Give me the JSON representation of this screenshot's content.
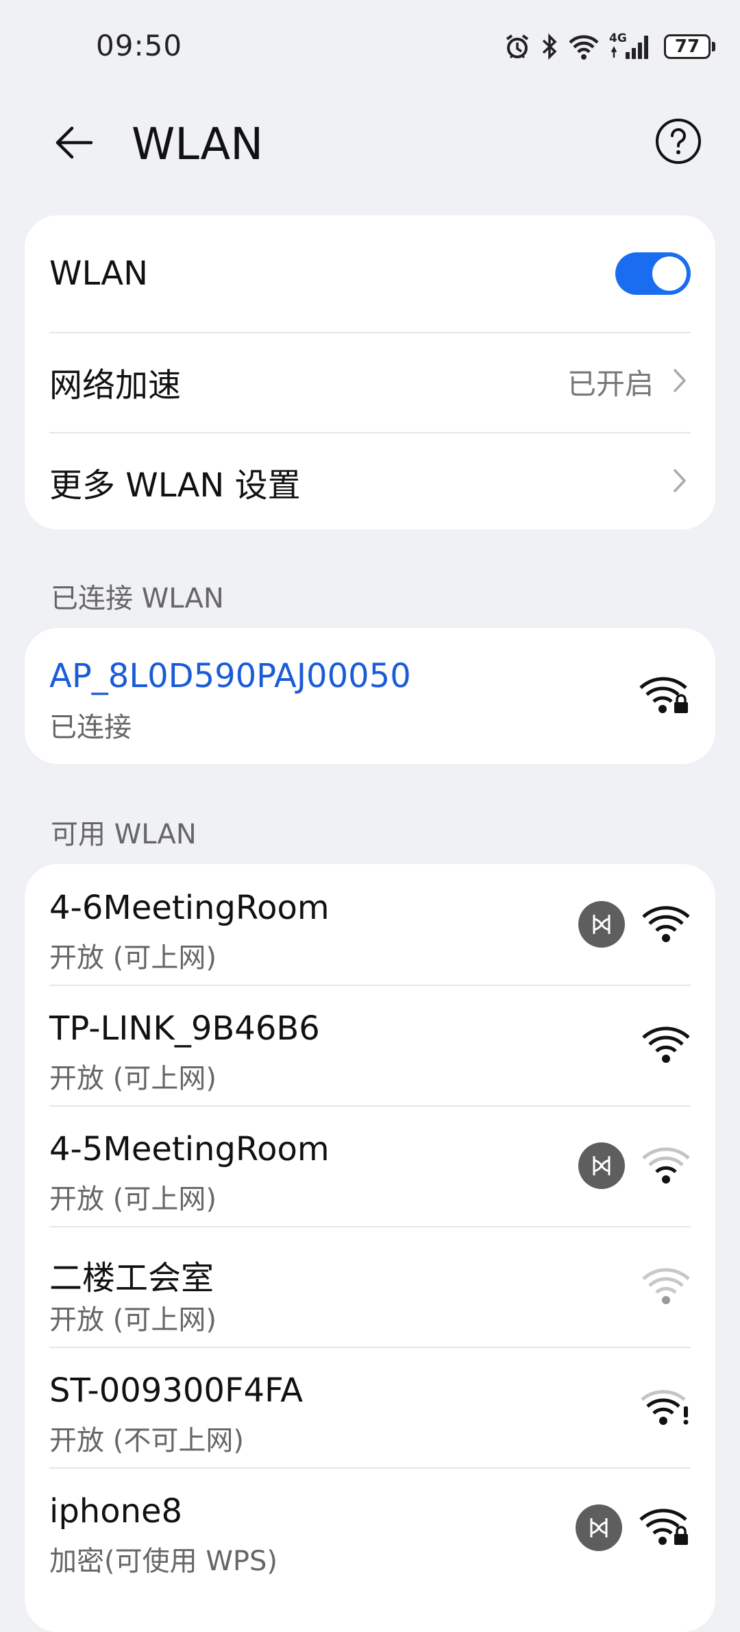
{
  "status_bar": {
    "time": "09:50",
    "network_type": "4G",
    "battery": "77",
    "icons": [
      "alarm-icon",
      "bluetooth-icon",
      "wifi-icon",
      "cellular-signal-icon",
      "battery-icon"
    ]
  },
  "header": {
    "title": "WLAN",
    "back_icon": "back-arrow-icon",
    "help_icon": "help-icon"
  },
  "settings": {
    "wlan_label": "WLAN",
    "wlan_enabled": true,
    "acceleration_label": "网络加速",
    "acceleration_value": "已开启",
    "more_settings_label": "更多 WLAN 设置"
  },
  "connected_section": {
    "title": "已连接 WLAN",
    "network": {
      "name": "AP_8L0D590PAJ00050",
      "status": "已连接",
      "secured": true
    }
  },
  "available_section": {
    "title": "可用 WLAN",
    "networks": [
      {
        "name": "4-6MeetingRoom",
        "status": "开放 (可上网)",
        "huawei_badge": true,
        "signal": "strong"
      },
      {
        "name": "TP-LINK_9B46B6",
        "status": "开放 (可上网)",
        "huawei_badge": false,
        "signal": "strong"
      },
      {
        "name": "4-5MeetingRoom",
        "status": "开放 (可上网)",
        "huawei_badge": true,
        "signal": "weak"
      },
      {
        "name": "二楼工会室",
        "status": "开放 (可上网)",
        "huawei_badge": false,
        "signal": "very-weak"
      },
      {
        "name": "ST-009300F4FA",
        "status": "开放 (不可上网)",
        "huawei_badge": false,
        "signal": "warning"
      },
      {
        "name": "iphone8",
        "status": "加密(可使用 WPS)",
        "huawei_badge": true,
        "signal": "locked"
      }
    ]
  },
  "colors": {
    "accent": "#1a6df0",
    "connected_text": "#1a5bd8",
    "background": "#f0f1f5"
  }
}
